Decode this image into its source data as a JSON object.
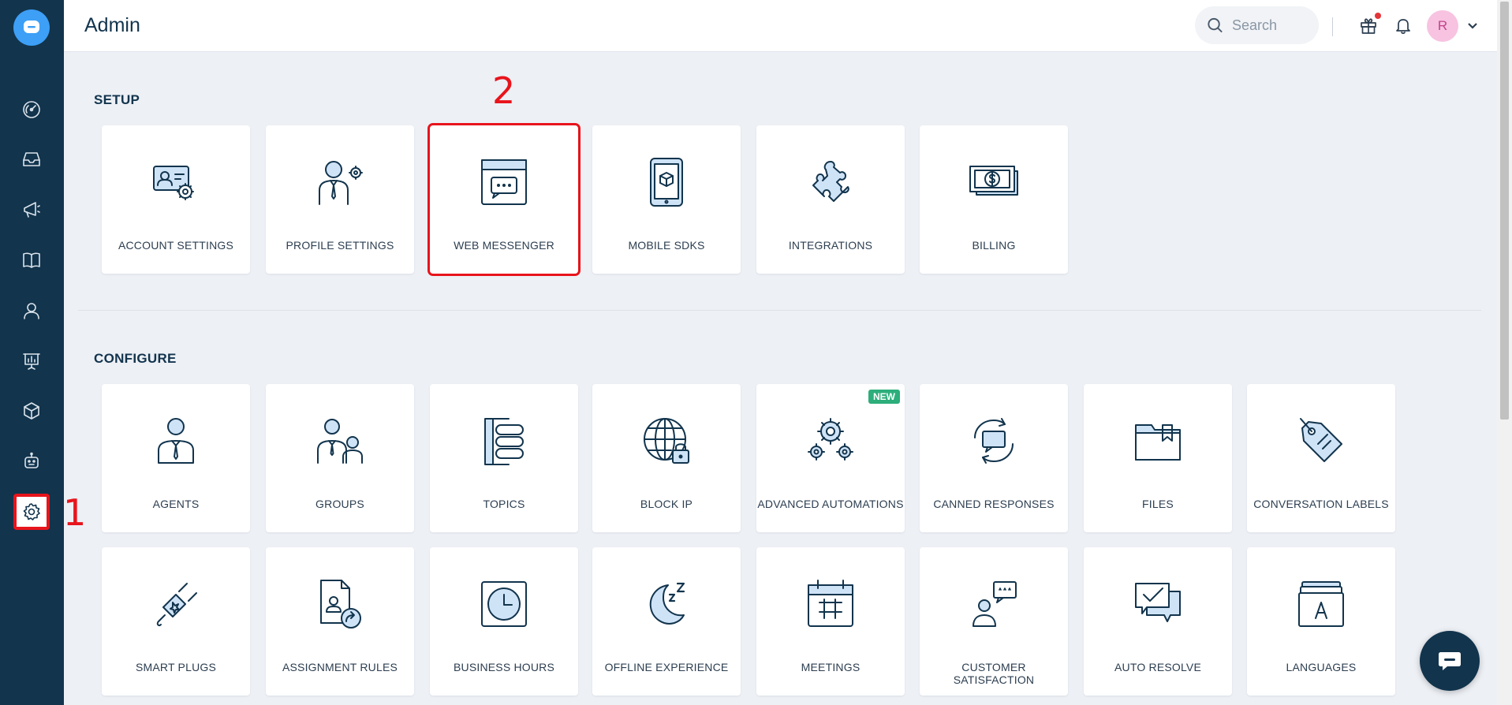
{
  "header": {
    "title": "Admin",
    "search_placeholder": "Search",
    "avatar_initial": "R"
  },
  "annotations": {
    "marker_1": "1",
    "marker_2": "2"
  },
  "colors": {
    "sidebar": "#12344d",
    "accent": "#3d9ff6",
    "highlight": "#e8141c",
    "new_badge": "#2dae7b"
  },
  "sidebar": {
    "items": [
      {
        "icon": "dashboard-icon"
      },
      {
        "icon": "inbox-icon"
      },
      {
        "icon": "megaphone-icon"
      },
      {
        "icon": "book-icon"
      },
      {
        "icon": "contact-icon"
      },
      {
        "icon": "analytics-icon"
      },
      {
        "icon": "cube-icon"
      },
      {
        "icon": "bot-icon"
      },
      {
        "icon": "gear-icon",
        "active": true
      }
    ]
  },
  "setup": {
    "title": "SETUP",
    "cards": [
      {
        "label": "ACCOUNT SETTINGS",
        "icon": "account-settings-icon"
      },
      {
        "label": "PROFILE SETTINGS",
        "icon": "profile-settings-icon"
      },
      {
        "label": "WEB MESSENGER",
        "icon": "web-messenger-icon"
      },
      {
        "label": "MOBILE SDKS",
        "icon": "mobile-sdk-icon"
      },
      {
        "label": "INTEGRATIONS",
        "icon": "puzzle-icon"
      },
      {
        "label": "BILLING",
        "icon": "billing-icon"
      }
    ]
  },
  "configure": {
    "title": "CONFIGURE",
    "cards": [
      {
        "label": "AGENTS",
        "icon": "agent-icon"
      },
      {
        "label": "GROUPS",
        "icon": "groups-icon"
      },
      {
        "label": "TOPICS",
        "icon": "topics-icon"
      },
      {
        "label": "BLOCK IP",
        "icon": "globe-lock-icon"
      },
      {
        "label": "ADVANCED AUTOMATIONS",
        "icon": "gears-icon",
        "badge": "NEW"
      },
      {
        "label": "CANNED RESPONSES",
        "icon": "canned-responses-icon"
      },
      {
        "label": "FILES",
        "icon": "folder-icon"
      },
      {
        "label": "CONVERSATION LABELS",
        "icon": "tag-icon"
      },
      {
        "label": "SMART PLUGS",
        "icon": "plug-icon"
      },
      {
        "label": "ASSIGNMENT RULES",
        "icon": "assignment-icon"
      },
      {
        "label": "BUSINESS HOURS",
        "icon": "clock-icon"
      },
      {
        "label": "OFFLINE EXPERIENCE",
        "icon": "moon-icon"
      },
      {
        "label": "MEETINGS",
        "icon": "calendar-icon"
      },
      {
        "label": "CUSTOMER SATISFACTION",
        "icon": "rating-icon"
      },
      {
        "label": "AUTO RESOLVE",
        "icon": "auto-resolve-icon"
      },
      {
        "label": "LANGUAGES",
        "icon": "languages-icon"
      }
    ]
  }
}
